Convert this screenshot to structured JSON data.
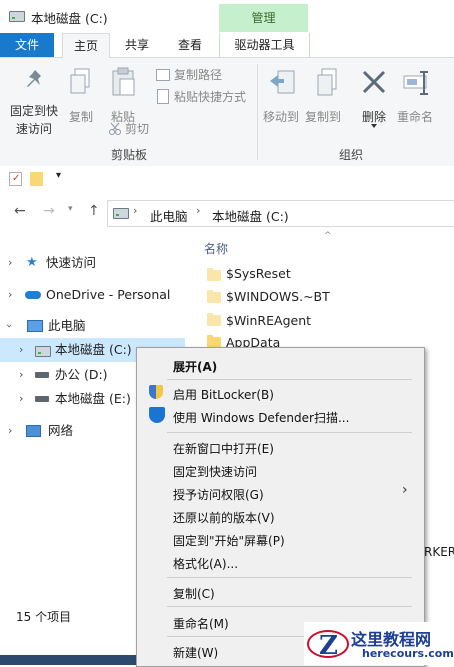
{
  "window": {
    "title": "本地磁盘 (C:)",
    "manage_tab": "管理"
  },
  "tabs": {
    "file": "文件",
    "home": "主页",
    "share": "共享",
    "view": "查看",
    "drive_tools": "驱动器工具"
  },
  "ribbon": {
    "pin_quick_access": "固定到快速访问",
    "pin_line1": "固定到快",
    "pin_line2": "速访问",
    "copy": "复制",
    "paste": "粘贴",
    "copy_path": "复制路径",
    "paste_shortcut": "粘贴快捷方式",
    "cut": "剪切",
    "clipboard_group": "剪贴板",
    "move_to": "移动到",
    "copy_to": "复制到",
    "delete": "删除",
    "rename": "重命名",
    "organize_group": "组织"
  },
  "address": {
    "this_pc": "此电脑",
    "drive": "本地磁盘 (C:)"
  },
  "nav": {
    "quick_access": "快速访问",
    "onedrive": "OneDrive - Personal",
    "this_pc": "此电脑",
    "drive_c": "本地磁盘 (C:)",
    "drive_d": "办公 (D:)",
    "drive_e": "本地磁盘 (E:)",
    "network": "网络"
  },
  "content": {
    "column_name": "名称",
    "files": [
      "$SysReset",
      "$WINDOWS.~BT",
      "$WinREAgent",
      "AppData"
    ],
    "partial_text": "RKER"
  },
  "status": {
    "item_count": "15 个项目"
  },
  "context_menu": {
    "expand": "展开(A)",
    "bitlocker": "启用 BitLocker(B)",
    "defender": "使用 Windows Defender扫描...",
    "open_new_window": "在新窗口中打开(E)",
    "pin_quick": "固定到快速访问",
    "grant_access": "授予访问权限(G)",
    "restore": "还原以前的版本(V)",
    "pin_start": "固定到\"开始\"屏幕(P)",
    "format": "格式化(A)...",
    "copy": "复制(C)",
    "rename": "重命名(M)",
    "new": "新建(W)"
  },
  "watermark": {
    "site_name": "这里教程网",
    "site_url": "herecours.com"
  }
}
